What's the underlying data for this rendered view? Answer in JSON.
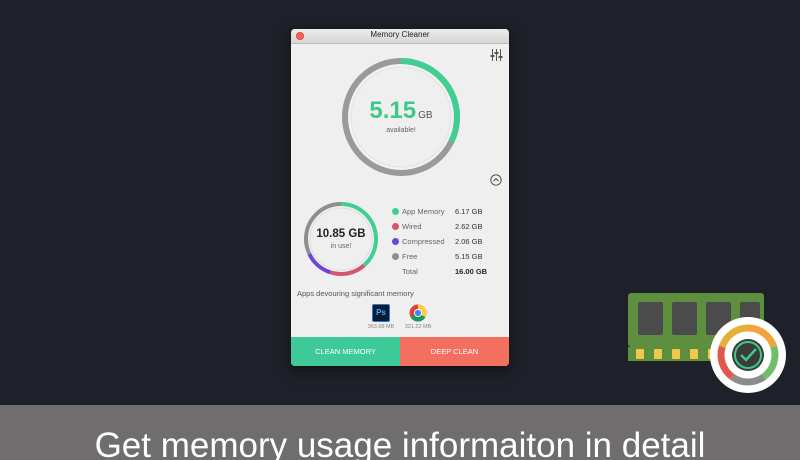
{
  "window": {
    "title": "Memory Cleaner"
  },
  "available": {
    "value": "5.15",
    "unit": "GB",
    "caption": "available!",
    "fraction": 0.322
  },
  "in_use": {
    "value": "10.85 GB",
    "caption": "in use!"
  },
  "memory_breakdown": [
    {
      "label": "App Memory",
      "value": "6.17 GB",
      "gb": 6.17,
      "color": "#3ecf91"
    },
    {
      "label": "Wired",
      "value": "2.62 GB",
      "gb": 2.62,
      "color": "#d2566c"
    },
    {
      "label": "Compressed",
      "value": "2.06 GB",
      "gb": 2.06,
      "color": "#6a45d6"
    },
    {
      "label": "Free",
      "value": "5.15 GB",
      "gb": 5.15,
      "color": "#8e8e8e"
    }
  ],
  "total": {
    "label": "Total",
    "value": "16.00 GB"
  },
  "apps": {
    "title": "Apps devouring significant memory",
    "items": [
      {
        "name": "Photoshop",
        "icon": "ps-icon",
        "size": "363.68 MB"
      },
      {
        "name": "Chrome",
        "icon": "chrome-icon",
        "size": "321.22 MB"
      }
    ]
  },
  "buttons": {
    "clean": "CLEAN MEMORY",
    "deep": "DEEP CLEAN"
  },
  "colors": {
    "accent_green": "#3ec998",
    "deep_clean_red": "#f36f60",
    "background": "#1e2129",
    "banner": "#6f6d6d"
  },
  "banner": {
    "text": "Get memory usage informaiton in detail"
  }
}
